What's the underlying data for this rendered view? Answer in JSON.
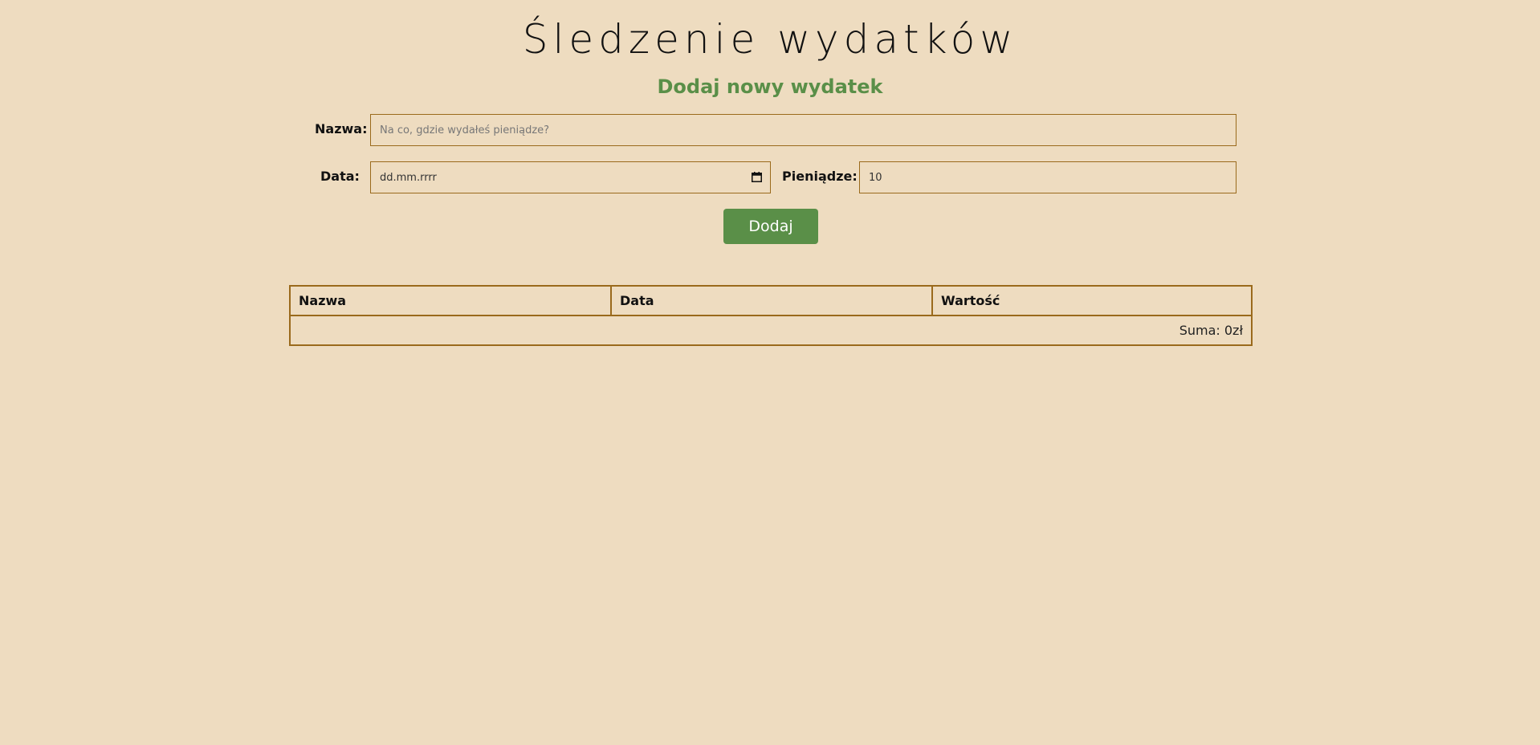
{
  "header": {
    "title": "Śledzenie wydatków",
    "subtitle": "Dodaj nowy wydatek"
  },
  "form": {
    "name_label": "Nazwa:",
    "name_placeholder": "Na co, gdzie wydałeś pieniądze?",
    "date_label": "Data:",
    "date_placeholder": "dd.mm.rrrr",
    "money_label": "Pieniądze:",
    "money_value": "10",
    "submit_label": "Dodaj"
  },
  "table": {
    "columns": [
      "Nazwa",
      "Data",
      "Wartość"
    ],
    "rows": [],
    "total": "Suma: 0zł"
  },
  "colors": {
    "background": "#eedcc0",
    "accent": "#5a8f48",
    "border": "#9a6a1c"
  },
  "icons": {
    "date_picker": "calendar-icon"
  }
}
